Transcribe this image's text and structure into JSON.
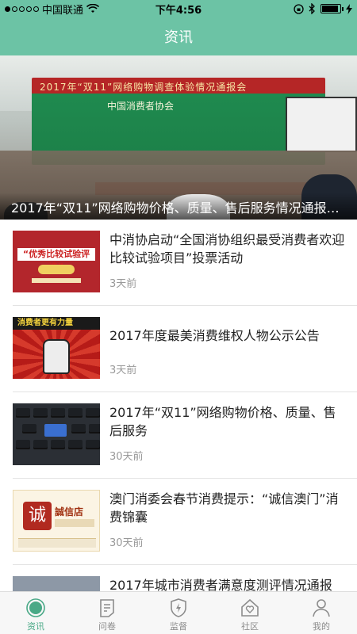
{
  "status_bar": {
    "carrier": "中国联通",
    "time": "下午4:56",
    "battery_level": 0.9
  },
  "nav": {
    "title": "资讯"
  },
  "hero": {
    "banner_text": "2017年“双11”网络购物调查体验情况通报会",
    "banner_org": "中国消费者协会",
    "caption": "2017年“双11”网络购物价格、质量、售后服务情况通报会..."
  },
  "news": [
    {
      "title": "中消协启动“全国消协组织最受消费者欢迎比较试验项目”投票活动",
      "time": "3天前",
      "thumb_text": "“优秀比较试验评选”"
    },
    {
      "title": "2017年度最美消费维权人物公示公告",
      "time": "3天前",
      "thumb_text": "消费者更有力量"
    },
    {
      "title": "2017年“双11”网络购物价格、质量、售后服务",
      "time": "30天前"
    },
    {
      "title": "澳门消委会春节消费提示：“诚信澳门”消费锦囊",
      "time": "30天前",
      "thumb_seal": "诚",
      "thumb_text": "誠信店"
    },
    {
      "title": "2017年城市消费者满意度测评情况通报",
      "time": ""
    }
  ],
  "tabs": [
    {
      "label": "资讯",
      "icon": "news-icon",
      "active": true
    },
    {
      "label": "问卷",
      "icon": "questionnaire-icon",
      "active": false
    },
    {
      "label": "监督",
      "icon": "shield-icon",
      "active": false
    },
    {
      "label": "社区",
      "icon": "community-icon",
      "active": false
    },
    {
      "label": "我的",
      "icon": "profile-icon",
      "active": false
    }
  ],
  "colors": {
    "brand": "#6cc3a5",
    "tab_active": "#4aa987"
  }
}
